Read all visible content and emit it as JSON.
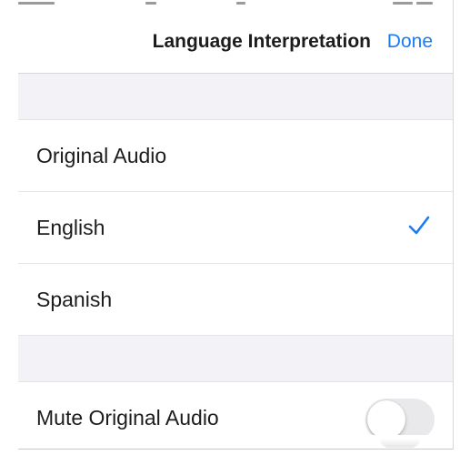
{
  "nav": {
    "title": "Language Interpretation",
    "done_label": "Done"
  },
  "languages": {
    "items": [
      {
        "label": "Original Audio",
        "selected": false
      },
      {
        "label": "English",
        "selected": true
      },
      {
        "label": "Spanish",
        "selected": false
      }
    ]
  },
  "settings": {
    "mute_original_label": "Mute Original Audio",
    "mute_original_on": false
  },
  "colors": {
    "accent": "#1a7cf5",
    "group_background": "#f2f2f7",
    "toggle_off": "#e9e9eb",
    "text": "#1c1c1e"
  },
  "icons": {
    "selected_indicator": "checkmark-icon"
  }
}
